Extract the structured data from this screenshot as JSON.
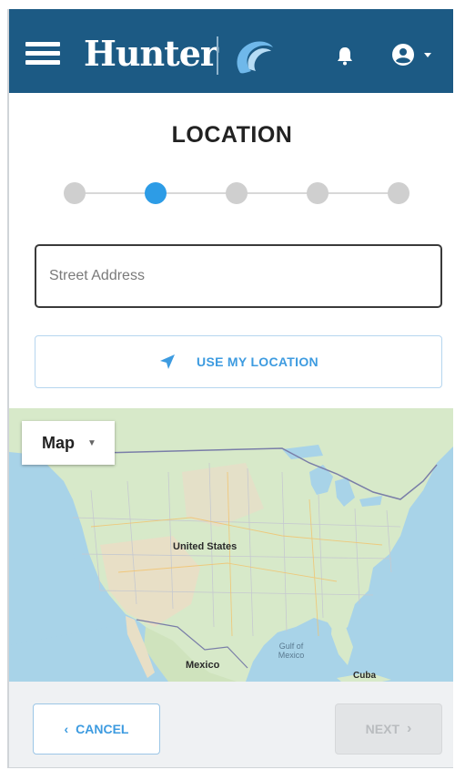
{
  "header": {
    "brand": "Hunter",
    "icons": [
      "menu-icon",
      "hunter-logo",
      "bell-icon",
      "account-icon",
      "caret-down-icon"
    ],
    "background": "#1c5a84"
  },
  "page": {
    "title": "LOCATION"
  },
  "stepper": {
    "total_steps": 5,
    "current_step": 2,
    "active_color": "#2d9ce6"
  },
  "address": {
    "placeholder": "Street Address",
    "value": ""
  },
  "use_location": {
    "label": "USE MY LOCATION",
    "icon": "navigation-arrow-icon"
  },
  "map": {
    "type_selector": "Map",
    "labels": {
      "country_us": "United States",
      "country_mexico": "Mexico",
      "gulf": "Gulf of Mexico",
      "cuba": "Cuba"
    }
  },
  "footer": {
    "cancel_label": "CANCEL",
    "next_label": "NEXT"
  }
}
